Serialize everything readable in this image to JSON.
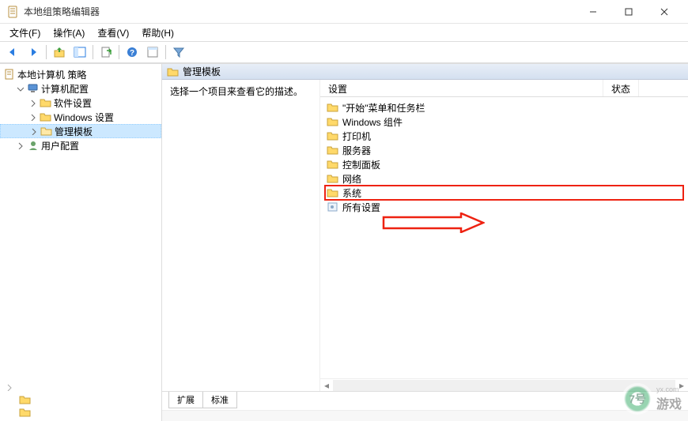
{
  "window": {
    "title": "本地组策略编辑器"
  },
  "menubar": {
    "file": "文件(F)",
    "action": "操作(A)",
    "view": "查看(V)",
    "help": "帮助(H)"
  },
  "tree": {
    "root": "本地计算机 策略",
    "computer_config": "计算机配置",
    "software_settings": "软件设置",
    "windows_settings": "Windows 设置",
    "admin_templates": "管理模板",
    "user_config": "用户配置"
  },
  "content": {
    "header_title": "管理模板",
    "description": "选择一个项目来查看它的描述。",
    "columns": {
      "setting": "设置",
      "status": "状态"
    },
    "items": [
      "\"开始\"菜单和任务栏",
      "Windows 组件",
      "打印机",
      "服务器",
      "控制面板",
      "网络",
      "系统",
      "所有设置"
    ]
  },
  "footer_tabs": {
    "extended": "扩展",
    "standard": "标准"
  },
  "watermark": {
    "logo_text": "7号",
    "text": "游戏",
    "url": "yx.com"
  }
}
